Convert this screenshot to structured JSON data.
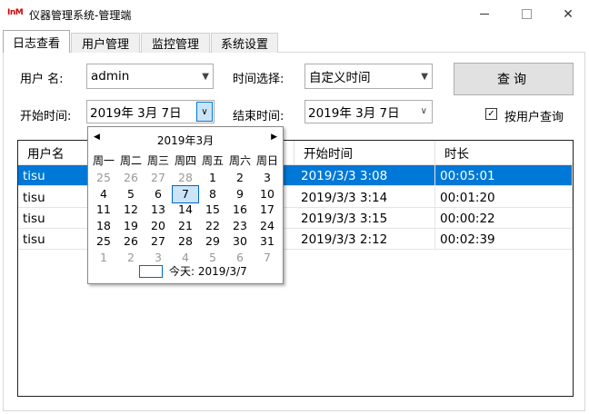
{
  "window": {
    "logo_text": "InM",
    "title": "仪器管理系统-管理端",
    "min_symbol": "",
    "max_symbol": "",
    "close_symbol": "✕"
  },
  "tabs": [
    {
      "label": "日志查看",
      "active": true
    },
    {
      "label": "用户管理",
      "active": false
    },
    {
      "label": "监控管理",
      "active": false
    },
    {
      "label": "系统设置",
      "active": false
    }
  ],
  "form": {
    "username_label": "用户 名:",
    "username_value": "admin",
    "time_select_label": "时间选择:",
    "time_select_value": "自定义时间",
    "start_time_label": "开始时间:",
    "start_date_value": "2019年  3月  7日",
    "end_time_label": "结束时间:",
    "end_date_value": "2019年  3月  7日",
    "query_button": "查询",
    "by_user_label": "按用户查询",
    "by_user_checked": true
  },
  "grid": {
    "columns": [
      "用户名",
      "",
      "开始时间",
      "时长"
    ],
    "rows": [
      {
        "user": "tisu",
        "start": "2019/3/3 3:08",
        "duration": "00:05:01",
        "selected": true
      },
      {
        "user": "tisu",
        "start": "2019/3/3 3:14",
        "duration": "00:01:20",
        "selected": false
      },
      {
        "user": "tisu",
        "start": "2019/3/3 3:15",
        "duration": "00:00:22",
        "selected": false
      },
      {
        "user": "tisu",
        "start": "2019/3/3 2:12",
        "duration": "00:02:39",
        "selected": false
      }
    ]
  },
  "calendar": {
    "title": "2019年3月",
    "prev": "◀",
    "next": "▶",
    "weekdays": [
      "周一",
      "周二",
      "周三",
      "周四",
      "周五",
      "周六",
      "周日"
    ],
    "weeks": [
      [
        "25",
        "26",
        "27",
        "28",
        "1",
        "2",
        "3"
      ],
      [
        "4",
        "5",
        "6",
        "7",
        "8",
        "9",
        "10"
      ],
      [
        "11",
        "12",
        "13",
        "14",
        "15",
        "16",
        "17"
      ],
      [
        "18",
        "19",
        "20",
        "21",
        "22",
        "23",
        "24"
      ],
      [
        "25",
        "26",
        "27",
        "28",
        "29",
        "30",
        "31"
      ],
      [
        "1",
        "2",
        "3",
        "4",
        "5",
        "6",
        "7"
      ]
    ],
    "today_label": "今天: 2019/3/7"
  }
}
